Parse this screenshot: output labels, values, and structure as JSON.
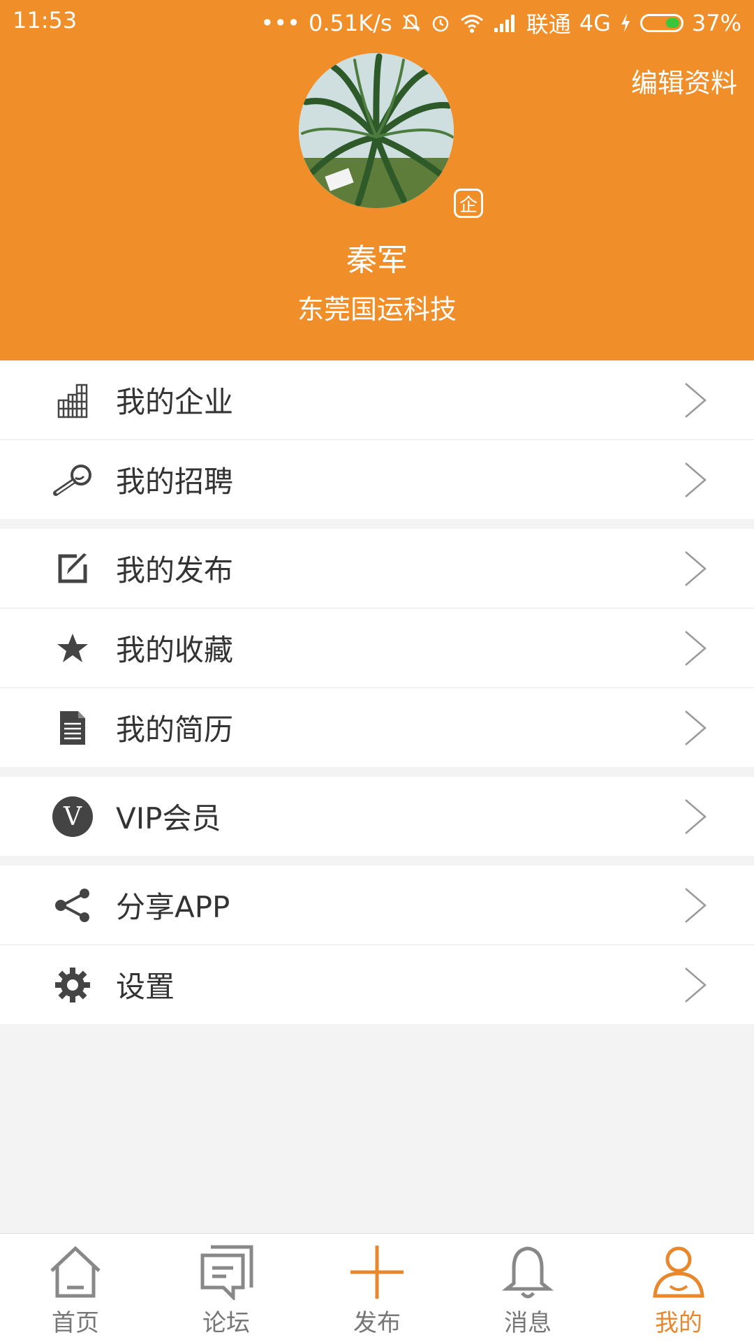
{
  "status_bar": {
    "time": "11:53",
    "dots": "•••",
    "net_speed": "0.51K/s",
    "carrier": "联通",
    "network": "4G",
    "battery": "37%",
    "battery_level": 0.37
  },
  "header": {
    "edit_label": "编辑资料",
    "user_name": "秦军",
    "company": "东莞国运科技",
    "badge": "企",
    "accent_color": "#f08f29"
  },
  "menu": {
    "groups": [
      [
        {
          "label": "我的企业",
          "icon": "building-icon"
        },
        {
          "label": "我的招聘",
          "icon": "magnifier-icon"
        }
      ],
      [
        {
          "label": "我的发布",
          "icon": "edit-icon"
        },
        {
          "label": "我的收藏",
          "icon": "star-icon"
        },
        {
          "label": "我的简历",
          "icon": "document-icon"
        }
      ],
      [
        {
          "label": "VIP会员",
          "icon": "vip-icon"
        }
      ],
      [
        {
          "label": "分享APP",
          "icon": "share-icon"
        },
        {
          "label": "设置",
          "icon": "gear-icon"
        }
      ]
    ],
    "vip_letter": "V"
  },
  "tabbar": {
    "tabs": [
      {
        "label": "首页",
        "icon": "home-icon"
      },
      {
        "label": "论坛",
        "icon": "forum-icon"
      },
      {
        "label": "发布",
        "icon": "plus-icon"
      },
      {
        "label": "消息",
        "icon": "bell-icon"
      },
      {
        "label": "我的",
        "icon": "user-icon",
        "active": true
      }
    ],
    "active_color": "#e8872c"
  }
}
